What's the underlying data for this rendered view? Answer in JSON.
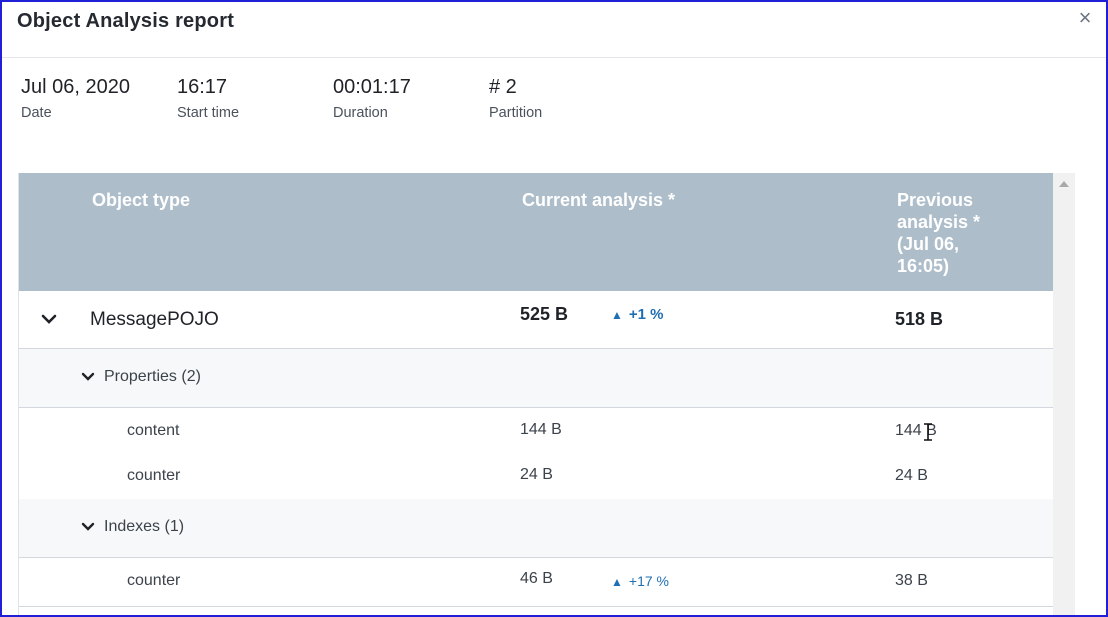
{
  "dialog": {
    "title": "Object Analysis report",
    "close_icon": "×"
  },
  "summary": {
    "date": {
      "value": "Jul 06, 2020",
      "label": "Date"
    },
    "start_time": {
      "value": "16:17",
      "label": "Start time"
    },
    "duration": {
      "value": "00:01:17",
      "label": "Duration"
    },
    "partition": {
      "value": "# 2",
      "label": "Partition"
    }
  },
  "table": {
    "headers": {
      "object_type": "Object type",
      "current": "Current analysis *",
      "previous": "Previous analysis * (Jul 06, 16:05)"
    },
    "object": {
      "name": "MessagePOJO",
      "current": "525 B",
      "change": "+1 %",
      "previous": "518 B"
    },
    "properties_group": {
      "label": "Properties (2)",
      "rows": [
        {
          "name": "content",
          "current": "144 B",
          "previous": "144 B"
        },
        {
          "name": "counter",
          "current": "24 B",
          "previous": "24 B"
        }
      ]
    },
    "indexes_group": {
      "label": "Indexes (1)",
      "rows": [
        {
          "name": "counter",
          "current": "46 B",
          "change": "+17 %",
          "previous": "38 B"
        }
      ]
    }
  },
  "colors": {
    "header_bg": "#adbdca",
    "accent": "#1f6fb3",
    "frame": "#1f1fd6",
    "group_bg": "#f7f8f9"
  }
}
